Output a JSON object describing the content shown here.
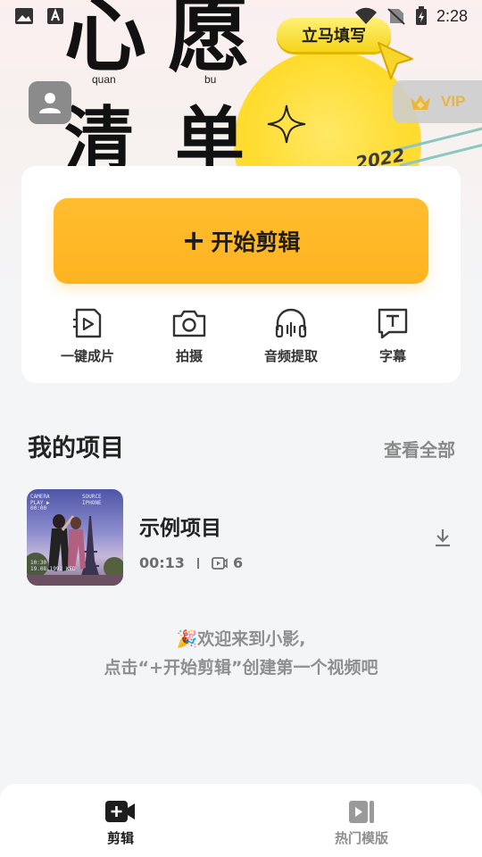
{
  "status_bar": {
    "time": "2:28"
  },
  "banner": {
    "char1": "心",
    "char2": "愿",
    "char3": "清",
    "char4": "单",
    "pinyin1": "quan",
    "pinyin2": "bu",
    "year": "2022",
    "promo_label": "立马填写"
  },
  "vip": {
    "label": "VIP"
  },
  "main": {
    "start_edit_label": "开始剪辑",
    "tools": [
      {
        "label": "一键成片",
        "icon": "video-file-icon"
      },
      {
        "label": "拍摄",
        "icon": "camera-icon"
      },
      {
        "label": "音频提取",
        "icon": "headphones-icon"
      },
      {
        "label": "字幕",
        "icon": "text-icon"
      }
    ]
  },
  "projects": {
    "title": "我的项目",
    "view_all": "查看全部",
    "items": [
      {
        "name": "示例项目",
        "duration": "00:13",
        "clip_count": "6",
        "thumb_text_tl": "CAMERA\nPLAY ▶\n00:00",
        "thumb_text_tr": "SOURCE\nIPHONE",
        "thumb_text_bl": "10:30\n19.08.1992 WED"
      }
    ]
  },
  "welcome": {
    "line1": "🎉欢迎来到小影,",
    "line2": "点击“+开始剪辑”创建第一个视频吧"
  },
  "bottom_nav": {
    "items": [
      {
        "label": "剪辑",
        "active": true
      },
      {
        "label": "热门模版",
        "active": false
      }
    ]
  },
  "colors": {
    "accent": "#ffb320",
    "vip_gold": "#e5b54a",
    "nav_active": "#1d1d1d",
    "nav_inactive": "#8f8f8f"
  }
}
